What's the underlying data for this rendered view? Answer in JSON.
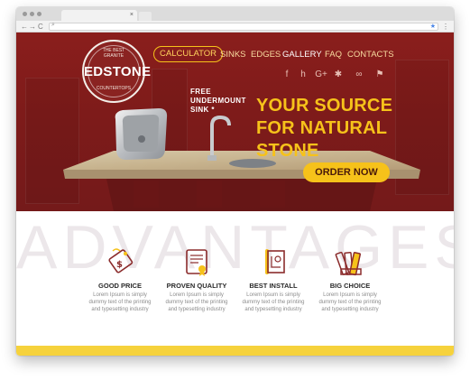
{
  "browser": {
    "tab_close": "×",
    "nav": {
      "back": "←",
      "forward": "→",
      "reload": "C"
    },
    "url_search_glyph": "⌕",
    "star_glyph": "★",
    "menu_glyph": "⋮"
  },
  "logo": {
    "name": "EDSTONE",
    "arc_top": "THE BEST GRANITE",
    "arc_bottom": "COUNTERTOPS"
  },
  "nav": {
    "items": [
      {
        "label": "CALCULATOR",
        "active": true
      },
      {
        "label": "SINKS"
      },
      {
        "label": "EDGES"
      },
      {
        "label": "GALLERY",
        "highlight": true
      },
      {
        "label": "FAQ"
      },
      {
        "label": "CONTACTS"
      }
    ]
  },
  "socials": [
    {
      "icon": "facebook-icon",
      "glyph": "f"
    },
    {
      "icon": "houzz-icon",
      "glyph": "h"
    },
    {
      "icon": "google-plus-icon",
      "glyph": "G+"
    },
    {
      "icon": "yelp-icon",
      "glyph": "✱"
    },
    {
      "icon": "tripadvisor-icon",
      "glyph": "∞"
    },
    {
      "icon": "foursquare-icon",
      "glyph": "⚑"
    }
  ],
  "promo": {
    "free_line1": "FREE",
    "free_line2": "UNDERMOUNT",
    "free_line3": "SINK *"
  },
  "hero": {
    "headline_line1": "YOUR SOURCE",
    "headline_line2": "FOR NATURAL STONE",
    "cta": "ORDER NOW"
  },
  "advantages": {
    "watermark": "ADVANTAGES",
    "items": [
      {
        "icon": "price-tag-icon",
        "title": "GOOD PRICE",
        "text1": "Lorem Ipsum is simply",
        "text2": "dummy text of the printing",
        "text3": "and typesetting industry"
      },
      {
        "icon": "certificate-icon",
        "title": "PROVEN QUALITY",
        "text1": "Lorem Ipsum is simply",
        "text2": "dummy text of the printing",
        "text3": "and typesetting industry"
      },
      {
        "icon": "blueprint-icon",
        "title": "BEST INSTALL",
        "text1": "Lorem Ipsum is simply",
        "text2": "dummy text of the printing",
        "text3": "and typesetting industry"
      },
      {
        "icon": "color-swatch-icon",
        "title": "BIG CHOICE",
        "text1": "Lorem Ipsum is simply",
        "text2": "dummy text of the printing",
        "text3": "and typesetting industry"
      }
    ]
  },
  "colors": {
    "brand_red": "#7e1b1a",
    "accent_yellow": "#f6c21a",
    "icon_maroon": "#8b2c2c",
    "footer_yellow": "#f6d23c"
  }
}
